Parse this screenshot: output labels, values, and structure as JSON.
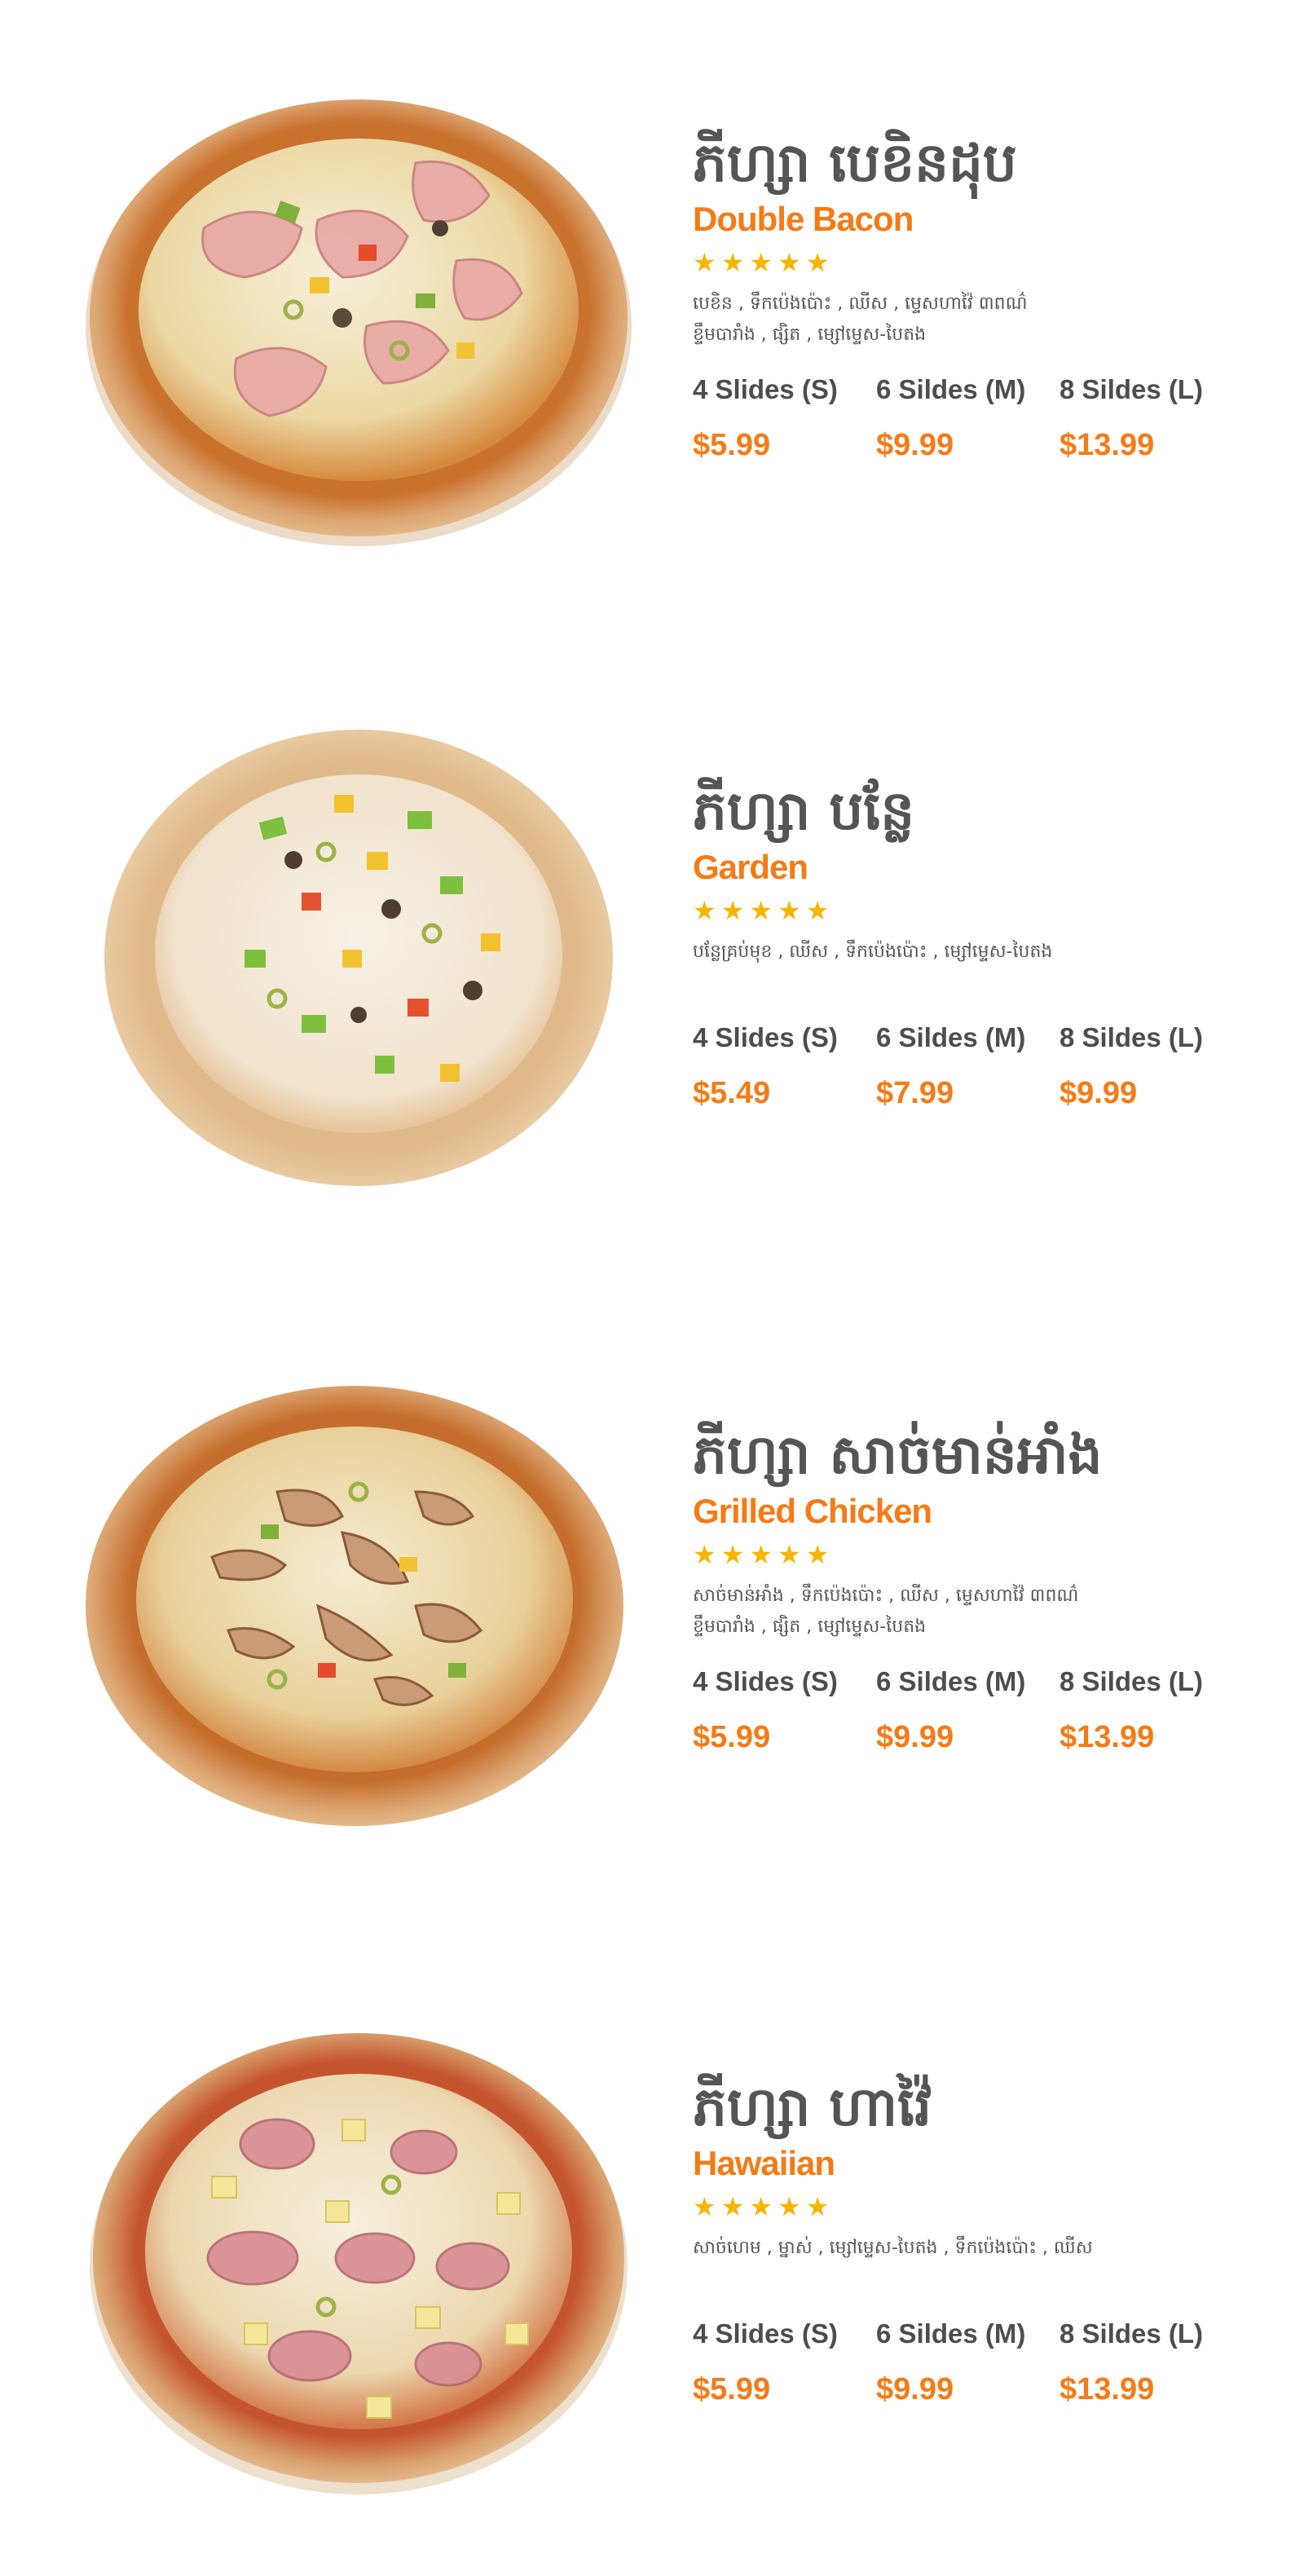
{
  "items": [
    {
      "khmer_name": "ភីហ្សា បេខិនដុប",
      "english_name": "Double Bacon",
      "rating": 5,
      "stars": [
        "★",
        "★",
        "★",
        "★",
        "★"
      ],
      "ingredients": [
        "បេខិន , ទឹកប៉េងប៉ោះ , ឈីស , ម្ទេសហាវ៉ៃ ៣ពណ៌",
        "ខ្ទឹមបារាំង , ផ្សិត , ម្សៅម្ទេស-បៃតង"
      ],
      "sizes": [
        {
          "label": "4 Slides (S)",
          "price": "$5.99"
        },
        {
          "label": "6 Sildes (M)",
          "price": "$9.99"
        },
        {
          "label": "8 Sildes (L)",
          "price": "$13.99"
        }
      ]
    },
    {
      "khmer_name": "ភីហ្សា បន្លែ",
      "english_name": "Garden",
      "rating": 5,
      "stars": [
        "★",
        "★",
        "★",
        "★",
        "★"
      ],
      "ingredients": [
        "បន្លែគ្រប់មុខ , ឈីស , ទឹកប៉េងប៉ោះ , ម្សៅម្ទេស-បៃតង",
        ""
      ],
      "sizes": [
        {
          "label": "4 Slides (S)",
          "price": "$5.49"
        },
        {
          "label": "6 Sildes (M)",
          "price": "$7.99"
        },
        {
          "label": "8 Sildes (L)",
          "price": "$9.99"
        }
      ]
    },
    {
      "khmer_name": "ភីហ្សា សាច់មាន់អាំង",
      "english_name": "Grilled Chicken",
      "rating": 5,
      "stars": [
        "★",
        "★",
        "★",
        "★",
        "★"
      ],
      "ingredients": [
        "សាច់មាន់អាំង , ទឹកប៉េងប៉ោះ , ឈីស , ម្ទេសហាវ៉ៃ ៣ពណ៌",
        "ខ្ទឹមបារាំង , ផ្សិត , ម្សៅម្ទេស-បៃតង"
      ],
      "sizes": [
        {
          "label": "4 Slides (S)",
          "price": "$5.99"
        },
        {
          "label": "6 Sildes (M)",
          "price": "$9.99"
        },
        {
          "label": "8 Sildes (L)",
          "price": "$13.99"
        }
      ]
    },
    {
      "khmer_name": "ភីហ្សា ហាវ៉ៃ",
      "english_name": "Hawaiian",
      "rating": 5,
      "stars": [
        "★",
        "★",
        "★",
        "★",
        "★"
      ],
      "ingredients": [
        "សាច់ហេម , ម្នាស់ , ម្សៅម្ទេស-បៃតង , ទឹកប៉េងប៉ោះ , ឈីស",
        ""
      ],
      "sizes": [
        {
          "label": "4 Slides (S)",
          "price": "$5.99"
        },
        {
          "label": "6 Sildes (M)",
          "price": "$9.99"
        },
        {
          "label": "8 Sildes (L)",
          "price": "$13.99"
        }
      ]
    }
  ],
  "colors": {
    "accent": "#f47b16",
    "star": "#f7b500",
    "title": "#555555",
    "crust": "#e2b07a",
    "sauce": "#d9893e",
    "cheese": "#f4ead0"
  },
  "images": [
    {
      "icon": "double-bacon-pizza-image"
    },
    {
      "icon": "garden-pizza-image"
    },
    {
      "icon": "grilled-chicken-pizza-image"
    },
    {
      "icon": "hawaiian-pizza-image"
    }
  ]
}
